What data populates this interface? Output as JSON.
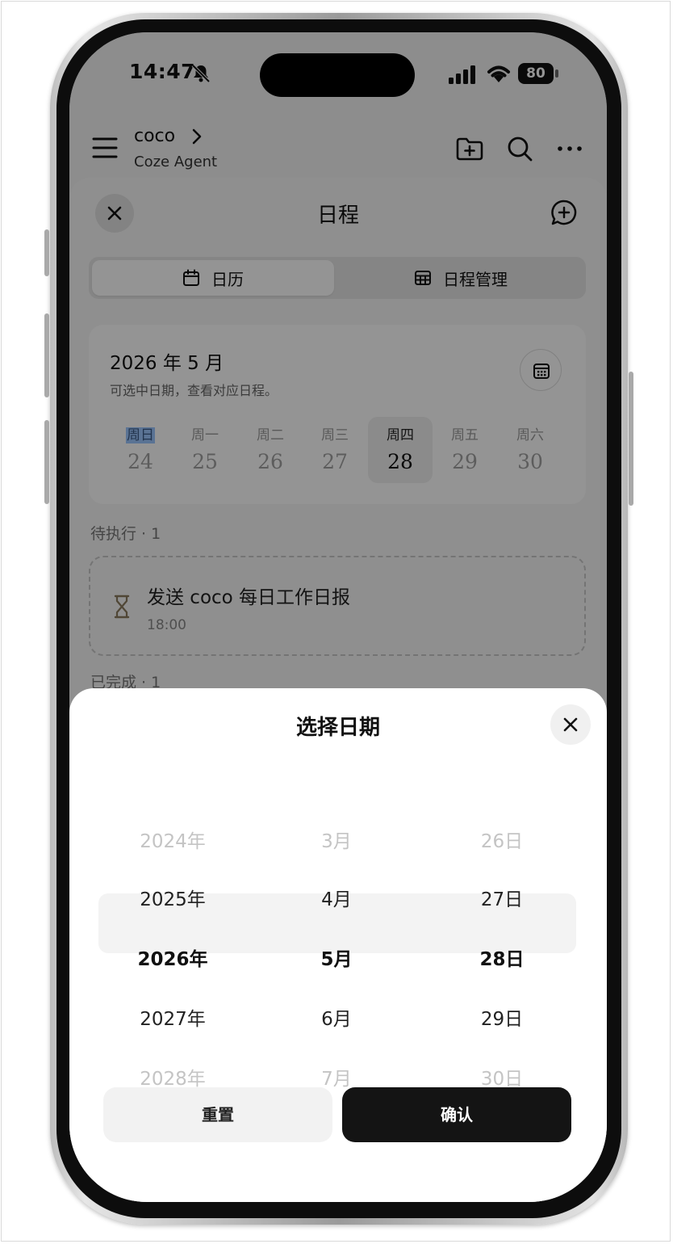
{
  "status_bar": {
    "time": "14:47",
    "battery": "80"
  },
  "app_header": {
    "agent_name": "coco",
    "agent_subtitle": "Coze Agent"
  },
  "schedule": {
    "title": "日程",
    "tabs": [
      {
        "label": "日历"
      },
      {
        "label": "日程管理"
      }
    ],
    "month_label": "2026 年 5 月",
    "hint": "可选中日期，查看对应日程。",
    "week": [
      {
        "weekday": "周日",
        "date": "24"
      },
      {
        "weekday": "周一",
        "date": "25"
      },
      {
        "weekday": "周二",
        "date": "26"
      },
      {
        "weekday": "周三",
        "date": "27"
      },
      {
        "weekday": "周四",
        "date": "28"
      },
      {
        "weekday": "周五",
        "date": "29"
      },
      {
        "weekday": "周六",
        "date": "30"
      }
    ],
    "pending_label": "待执行 · 1",
    "task": {
      "title": "发送 coco 每日工作日报",
      "time": "18:00"
    },
    "done_label": "已完成 · 1"
  },
  "date_picker": {
    "title": "选择日期",
    "years": [
      "2024年",
      "2025年",
      "2026年",
      "2027年",
      "2028年"
    ],
    "months": [
      "3月",
      "4月",
      "5月",
      "6月",
      "7月"
    ],
    "days": [
      "26日",
      "27日",
      "28日",
      "29日",
      "30日"
    ],
    "reset_label": "重置",
    "confirm_label": "确认"
  }
}
